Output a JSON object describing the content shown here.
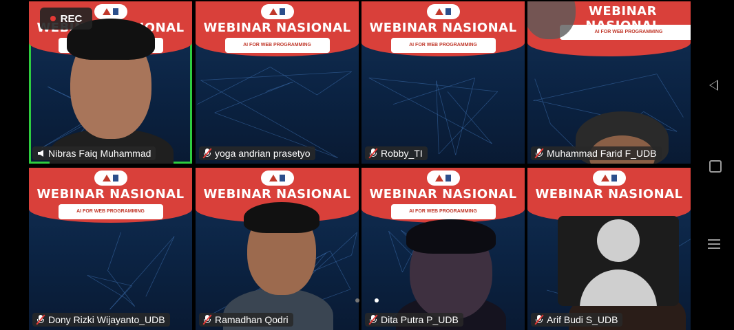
{
  "recording": {
    "label": "REC",
    "dot_color": "#e53935"
  },
  "banner": {
    "title": "WEBINAR NASIONAL",
    "subtitle": "AI FOR WEB PROGRAMMING"
  },
  "participants": [
    {
      "name": "Nibras Faiq Muhammad",
      "status": "speaking",
      "active_speaker": true
    },
    {
      "name": "yoga andrian prasetyo",
      "status": "muted"
    },
    {
      "name": "Robby_TI",
      "status": "muted"
    },
    {
      "name": "Muhammad Farid F_UDB",
      "status": "muted"
    },
    {
      "name": "Dony Rizki Wijayanto_UDB",
      "status": "muted"
    },
    {
      "name": "Ramadhan Qodri",
      "status": "muted"
    },
    {
      "name": "Dita Putra P_UDB",
      "status": "muted"
    },
    {
      "name": "Arif Budi S_UDB",
      "status": "muted"
    }
  ],
  "pager": {
    "pages": 2,
    "current": 2
  },
  "self_view": {
    "icon": "avatar-placeholder-icon"
  },
  "navbar": {
    "icons": [
      "back-icon",
      "home-icon",
      "recents-icon"
    ]
  },
  "colors": {
    "active_border": "#2ecc40",
    "banner_red": "#d9403a",
    "muted_red": "#e53935"
  }
}
